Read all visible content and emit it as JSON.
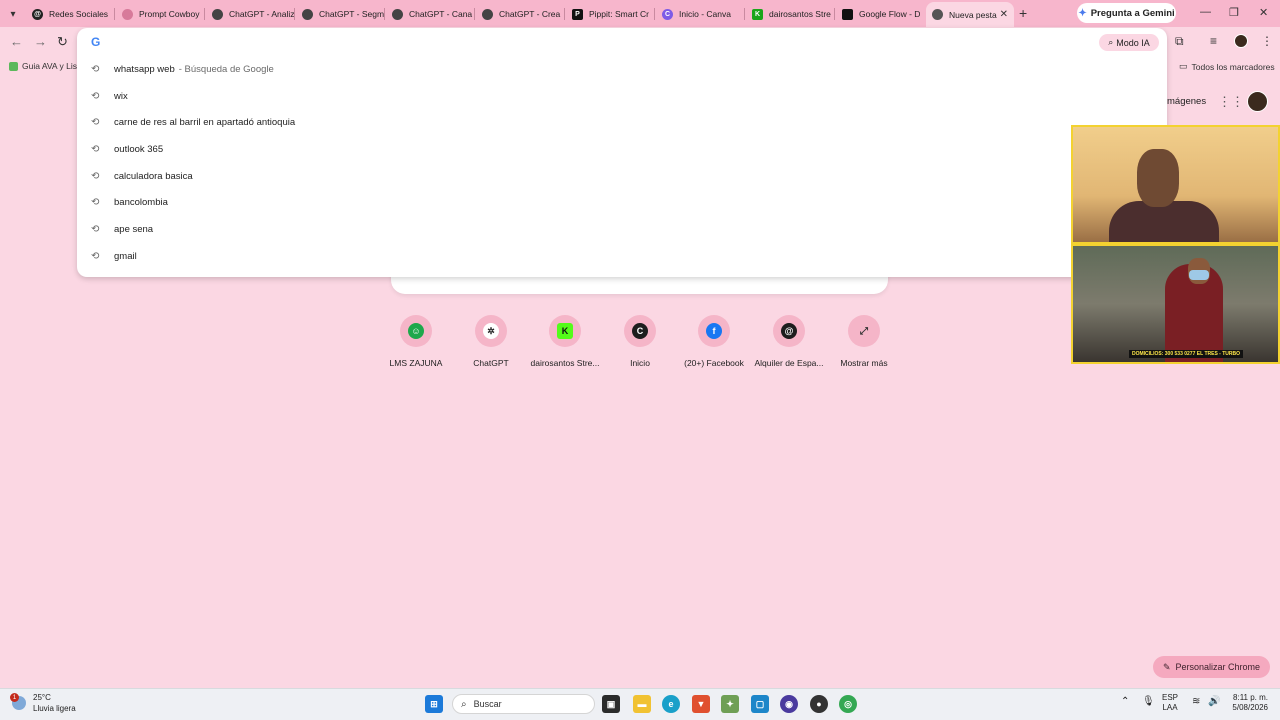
{
  "tabs": [
    {
      "label": "Redes Sociales",
      "favicon_color": "#222222"
    },
    {
      "label": "Prompt Cowboy",
      "favicon_color": "#d77a9a"
    },
    {
      "label": "ChatGPT - Analiz",
      "favicon_color": "#444444"
    },
    {
      "label": "ChatGPT - Segm",
      "favicon_color": "#444444"
    },
    {
      "label": "ChatGPT - Cana",
      "favicon_color": "#444444"
    },
    {
      "label": "ChatGPT - Crea",
      "favicon_color": "#444444"
    },
    {
      "label": "Pippit: Smart Cr",
      "favicon_color": "#111111"
    },
    {
      "label": "Inicio - Canva",
      "favicon_color": "#7d5be6"
    },
    {
      "label": "dairosantos Stre",
      "favicon_color": "#1aa51a"
    },
    {
      "label": "Google Flow - D",
      "favicon_color": "#111111"
    },
    {
      "label": "Nueva pesta",
      "favicon_color": "#555555"
    }
  ],
  "gemini_button": "Pregunta a Gemini",
  "omnibox": {
    "modo_ia": "Modo IA",
    "suggestions": [
      {
        "text": "whatsapp web",
        "extra": "- Búsqueda de Google"
      },
      {
        "text": "wix",
        "extra": ""
      },
      {
        "text": "carne de res al barril en apartadó antioquia",
        "extra": ""
      },
      {
        "text": "outlook 365",
        "extra": ""
      },
      {
        "text": "calculadora basica",
        "extra": ""
      },
      {
        "text": "bancolombia",
        "extra": ""
      },
      {
        "text": "ape sena",
        "extra": ""
      },
      {
        "text": "gmail",
        "extra": ""
      }
    ]
  },
  "bookmarks": {
    "first": "Guia AVA y Lista",
    "all": "Todos los marcadores"
  },
  "header_links": {
    "images": "mágenes"
  },
  "shortcuts": [
    {
      "label": "LMS ZAJUNA",
      "icon_color": "#1ea84b",
      "glyph": "☺"
    },
    {
      "label": "ChatGPT",
      "icon_color": "#ffffff",
      "glyph": "✲"
    },
    {
      "label": "dairosantos Stre...",
      "icon_color": "#53fc18",
      "glyph": "K"
    },
    {
      "label": "Inicio",
      "icon_color": "#1d1d1d",
      "glyph": "C"
    },
    {
      "label": "(20+) Facebook",
      "icon_color": "#1877f2",
      "glyph": "f"
    },
    {
      "label": "Alquiler de Espa...",
      "icon_color": "#1d1d1d",
      "glyph": "@"
    },
    {
      "label": "Mostrar más",
      "icon_color": "#f5b5c8",
      "glyph": "⤢"
    }
  ],
  "video_caption": "DOMICILIOS: 300 533 0277 EL TRES - TURBO",
  "personalize_button": "Personalizar Chrome",
  "taskbar": {
    "weather_temp": "25°C",
    "weather_desc": "Lluvia ligera",
    "weather_badge": "1",
    "search_label": "Buscar",
    "lang_line1": "ESP",
    "lang_line2": "LAA",
    "time": "8:11 p. m.",
    "date": "5/08/2026"
  }
}
